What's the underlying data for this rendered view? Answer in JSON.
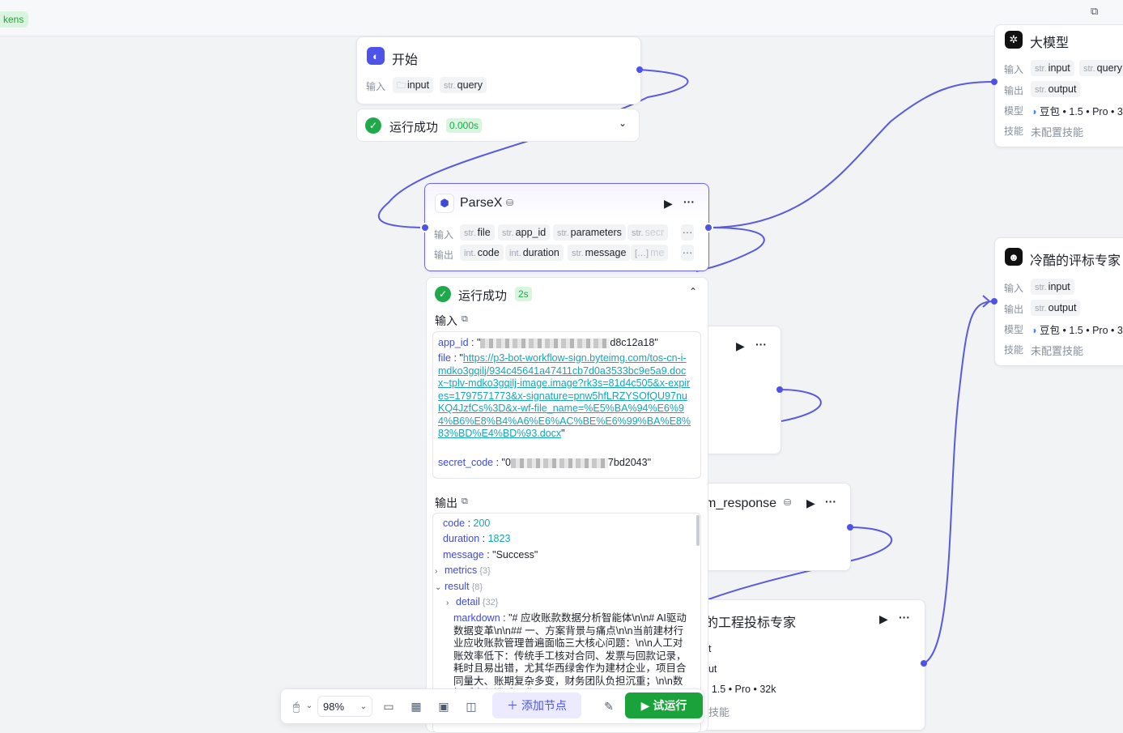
{
  "topbar": {
    "tokens_label": "kens"
  },
  "start_node": {
    "title": "开始",
    "input_label": "输入",
    "inputs": [
      {
        "type": "",
        "name": "input"
      },
      {
        "type": "str.",
        "name": "query"
      }
    ],
    "status": "运行成功",
    "time": "0.000s"
  },
  "parsex_node": {
    "title": "ParseX",
    "input_label": "输入",
    "output_label": "输出",
    "inputs": [
      {
        "type": "str.",
        "name": "file"
      },
      {
        "type": "str.",
        "name": "app_id"
      },
      {
        "type": "str.",
        "name": "parameters"
      },
      {
        "type": "str.",
        "name": "secr"
      }
    ],
    "outputs": [
      {
        "type": "int.",
        "name": "code"
      },
      {
        "type": "int.",
        "name": "duration"
      },
      {
        "type": "str.",
        "name": "message"
      },
      {
        "type": "[…]",
        "name": "me"
      }
    ],
    "more": "···",
    "status": "运行成功",
    "time": "2s",
    "input_section": "输入",
    "output_section": "输出",
    "input_values": {
      "app_id_key": "app_id",
      "app_id_tail": "d8c12a18\"",
      "file_key": "file",
      "file_value": "https://p3-bot-workflow-sign.byteimg.com/tos-cn-i-mdko3gqilj/934c45641a47411cb7d0a3533bc9e5a9.docx~tplv-mdko3gqilj-image.image?rk3s=81d4c505&x-expires=1797571773&x-signature=pnw5hfLRZYSOfQU97nuKQ4JzfCs%3D&x-wf-file_name=%E5%BA%94%E6%94%B6%E8%B4%A6%E6%AC%BE%E6%99%BA%E8%83%BD%E4%BD%93.docx",
      "secret_key": "secret_code",
      "secret_head": "\"0",
      "secret_tail": "7bd2043\""
    },
    "output_values": {
      "code_key": "code",
      "code_val": "200",
      "duration_key": "duration",
      "duration_val": "1823",
      "message_key": "message",
      "message_val": "\"Success\"",
      "metrics_key": "metrics",
      "metrics_count": "{3}",
      "result_key": "result",
      "result_count": "{8}",
      "detail_key": "detail",
      "detail_count": "{32}",
      "markdown_key": "markdown",
      "markdown_val": "\"# 应收账款数据分析智能体\\n\\n# AI驱动数据变革\\n\\n## 一、方案背景与痛点\\n\\n当前建材行业应收账款管理普遍面临三大核心问题：\\n\\n人工对账效率低下：传统手工核对合同、发票与回款记录，耗时且易出错，尤其华西绿舍作为建材企业，项目合同量大、账期复杂多变，财务团队负担沉重；\\n\\n数据孤岛与滞后：业"
    }
  },
  "large_model_node": {
    "title": "大模型",
    "input_label": "输入",
    "output_label": "输出",
    "model_label": "模型",
    "skill_label": "技能",
    "inputs": [
      {
        "type": "str.",
        "name": "input"
      },
      {
        "type": "str.",
        "name": "query"
      }
    ],
    "outputs": [
      {
        "type": "str.",
        "name": "output"
      }
    ],
    "model": "豆包 • 1.5 • Pro • 3",
    "skill": "未配置技能"
  },
  "expert_node": {
    "title": "冷酷的评标专家",
    "input_label": "输入",
    "output_label": "输出",
    "model_label": "模型",
    "skill_label": "技能",
    "inputs": [
      {
        "type": "str.",
        "name": "input"
      }
    ],
    "outputs": [
      {
        "type": "str.",
        "name": "output"
      }
    ],
    "model": "豆包 • 1.5 • Pro • 3",
    "skill": "未配置技能"
  },
  "response_node": {
    "title": "m_response"
  },
  "engineering_node": {
    "title": "的工程投标专家",
    "in_frag": "ut",
    "out_frag": "put",
    "model_frag": "• 1.5 • Pro • 32k",
    "skill_frag": "技能"
  },
  "toolbar": {
    "zoom": "98%",
    "add_node": "添加节点",
    "test_run": "试运行"
  },
  "colors": {
    "accent": "#4d53e8",
    "success": "#1aa33a",
    "edge": "#5b59e0"
  }
}
